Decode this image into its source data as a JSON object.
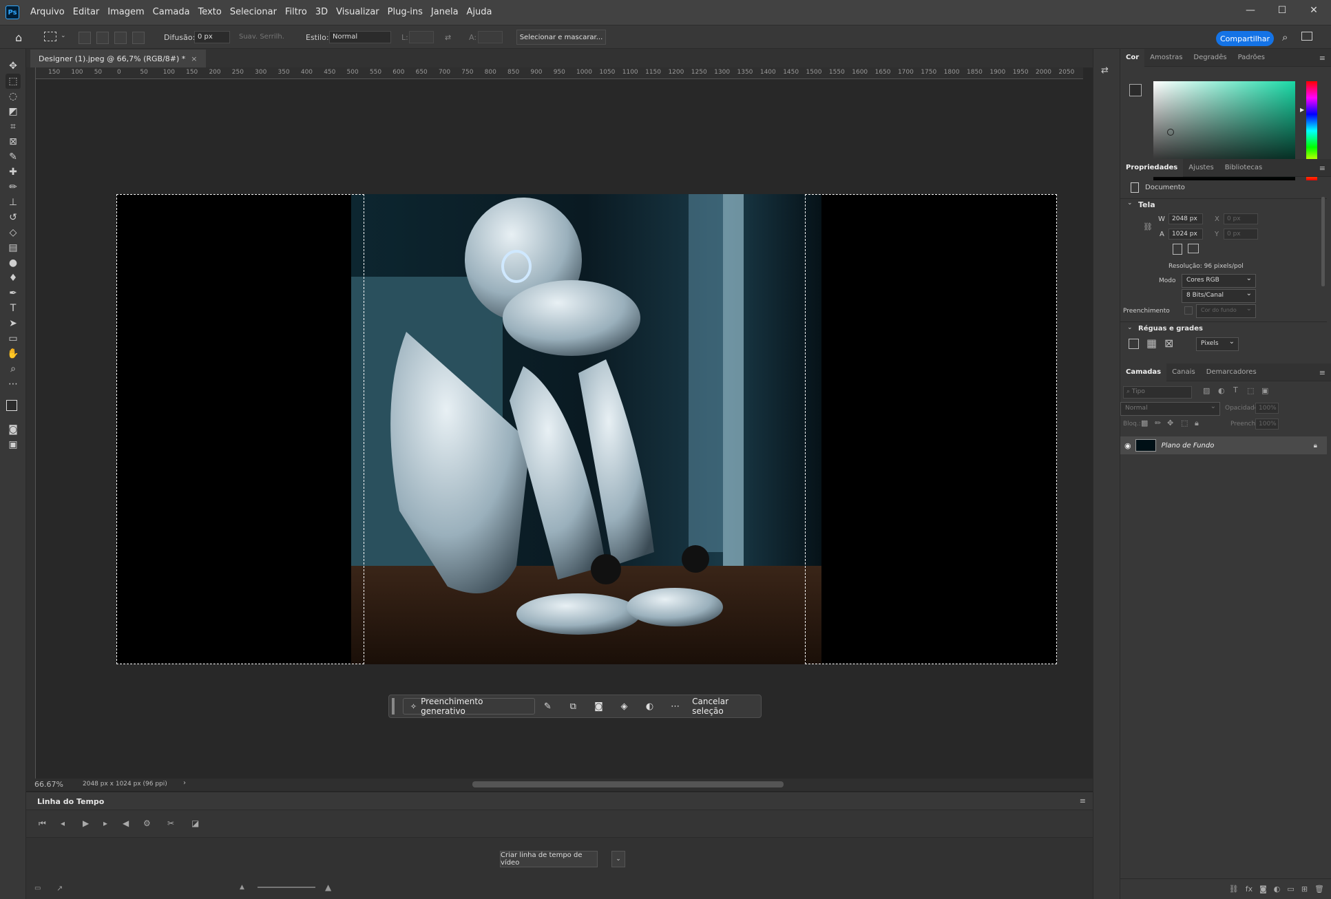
{
  "menubar": {
    "logo": "Ps",
    "items": [
      "Arquivo",
      "Editar",
      "Imagem",
      "Camada",
      "Texto",
      "Selecionar",
      "Filtro",
      "3D",
      "Visualizar",
      "Plug-ins",
      "Janela",
      "Ajuda"
    ],
    "win_min": "—",
    "win_max": "☐",
    "win_close": "✕"
  },
  "options": {
    "feather_label": "Difusão:",
    "feather_value": "0 px",
    "antialias_label": "Suav. Serrilh.",
    "style_label": "Estilo:",
    "style_value": "Normal",
    "width_label": "L:",
    "height_label": "A:",
    "select_mask": "Selecionar e mascarar...",
    "share": "Compartilhar"
  },
  "doc_tab": {
    "title": "Designer (1).jpeg @ 66,7% (RGB/8#) *",
    "close": "×"
  },
  "ruler_top": [
    "150",
    "100",
    "50",
    "0",
    "50",
    "100",
    "150",
    "200",
    "250",
    "300",
    "350",
    "400",
    "450",
    "500",
    "550",
    "600",
    "650",
    "700",
    "750",
    "800",
    "850",
    "900",
    "950",
    "1000",
    "1050",
    "1100",
    "1150",
    "1200",
    "1250",
    "1300",
    "1350",
    "1400",
    "1450",
    "1500",
    "1550",
    "1600",
    "1650",
    "1700",
    "1750",
    "1800",
    "1850",
    "1900",
    "1950",
    "2000",
    "2050"
  ],
  "context_bar": {
    "gen_fill": "Preenchimento generativo",
    "cancel": "Cancelar seleção"
  },
  "status": {
    "zoom": "66.67%",
    "info": "2048 px x 1024 px (96 ppi)"
  },
  "timeline": {
    "title": "Linha do Tempo",
    "create": "Criar linha de tempo de vídeo"
  },
  "color_panel": {
    "tabs": [
      "Cor",
      "Amostras",
      "Degradês",
      "Padrões"
    ]
  },
  "properties": {
    "tabs": [
      "Propriedades",
      "Ajustes",
      "Bibliotecas"
    ],
    "doc_label": "Documento",
    "canvas_header": "Tela",
    "w_label": "W",
    "w_value": "2048 px",
    "x_label": "X",
    "x_value": "0 px",
    "h_label": "A",
    "h_value": "1024 px",
    "y_label": "Y",
    "y_value": "0 px",
    "resolution": "Resolução: 96 pixels/pol",
    "mode_label": "Modo",
    "mode_value": "Cores RGB",
    "bits_value": "8 Bits/Canal",
    "fill_label": "Preenchimento",
    "fill_value": "Cor do fundo",
    "rulers_header": "Réguas e grades",
    "units_value": "Pixels"
  },
  "layers": {
    "tabs": [
      "Camadas",
      "Canais",
      "Demarcadores"
    ],
    "search_placeholder": "Tipo",
    "blend": "Normal",
    "opacity_label": "Opacidade:",
    "opacity_value": "100%",
    "lock_label": "Bloq.:",
    "fill_label": "Preench.:",
    "fill_value": "100%",
    "layer_name": "Plano de Fundo"
  },
  "colors": {
    "accent": "#1473e6",
    "bg": "#282828",
    "panel": "#383838"
  }
}
